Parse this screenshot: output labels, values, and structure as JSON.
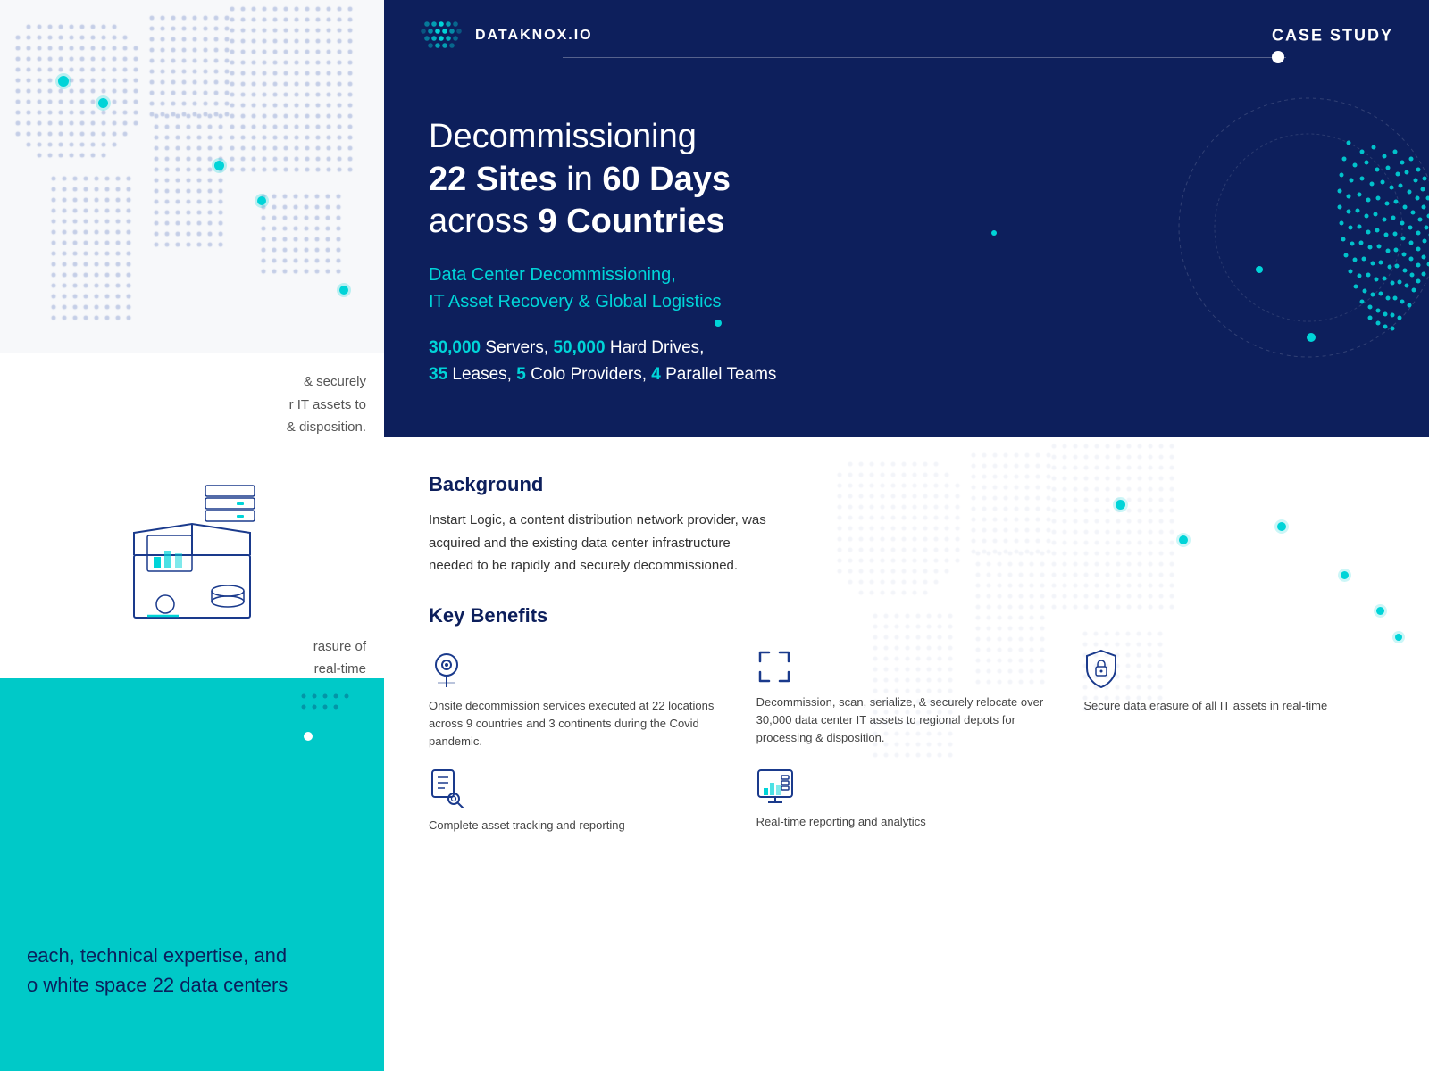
{
  "header": {
    "logo_text": "DATAKNOX.IO",
    "case_study_label": "CASE STUDY"
  },
  "hero": {
    "title_line1": "Decommissioning",
    "title_line2_pre": "",
    "title_bold1": "22 Sites",
    "title_mid": " in ",
    "title_bold2": "60 Days",
    "title_line3_pre": "across ",
    "title_bold3": "9 Countries",
    "subtitle_line1": "Data Center Decommissioning,",
    "subtitle_line2": "IT Asset Recovery & Global Logistics",
    "stats_line1_n1": "30,000",
    "stats_line1_t1": " Servers, ",
    "stats_line1_n2": "50,000",
    "stats_line1_t2": " Hard Drives,",
    "stats_line2_n1": "35",
    "stats_line2_t1": " Leases, ",
    "stats_line2_n2": "5",
    "stats_line2_t2": " Colo Providers, ",
    "stats_line2_n3": "4",
    "stats_line2_t3": " Parallel Teams"
  },
  "background": {
    "title": "Background",
    "text": "Instart Logic, a content distribution network provider, was acquired and the existing data center infrastructure needed to be rapidly and securely decommissioned."
  },
  "key_benefits": {
    "title": "Key Benefits",
    "items": [
      {
        "icon": "location-pin-icon",
        "text": "Onsite decommission services executed at 22 locations across 9 countries and 3 continents during the Covid pandemic."
      },
      {
        "icon": "scan-frame-icon",
        "text": "Decommission, scan, serialize, & securely relocate over 30,000 data center IT assets to regional depots for processing & disposition."
      },
      {
        "icon": "shield-lock-icon",
        "text": "Secure data erasure of all IT assets in real-time"
      },
      {
        "icon": "search-document-icon",
        "text": "Complete asset tracking and reporting"
      },
      {
        "icon": "chart-icon",
        "text": "Real-time reporting and analytics"
      }
    ]
  },
  "left_panel": {
    "text_mid1": "& securely",
    "text_mid2": "r IT assets to",
    "text_mid3": "& disposition.",
    "text_mid4": "rasure of",
    "text_mid5": "real-time",
    "text_bottom1": "each, technical expertise, and",
    "text_bottom2": "o white space 22 data centers"
  },
  "colors": {
    "navy": "#0d1f5c",
    "teal": "#00d4d8",
    "teal_bg": "#00c9c8",
    "white": "#ffffff",
    "light_gray": "#f7f8fa",
    "text_dark": "#333333"
  }
}
